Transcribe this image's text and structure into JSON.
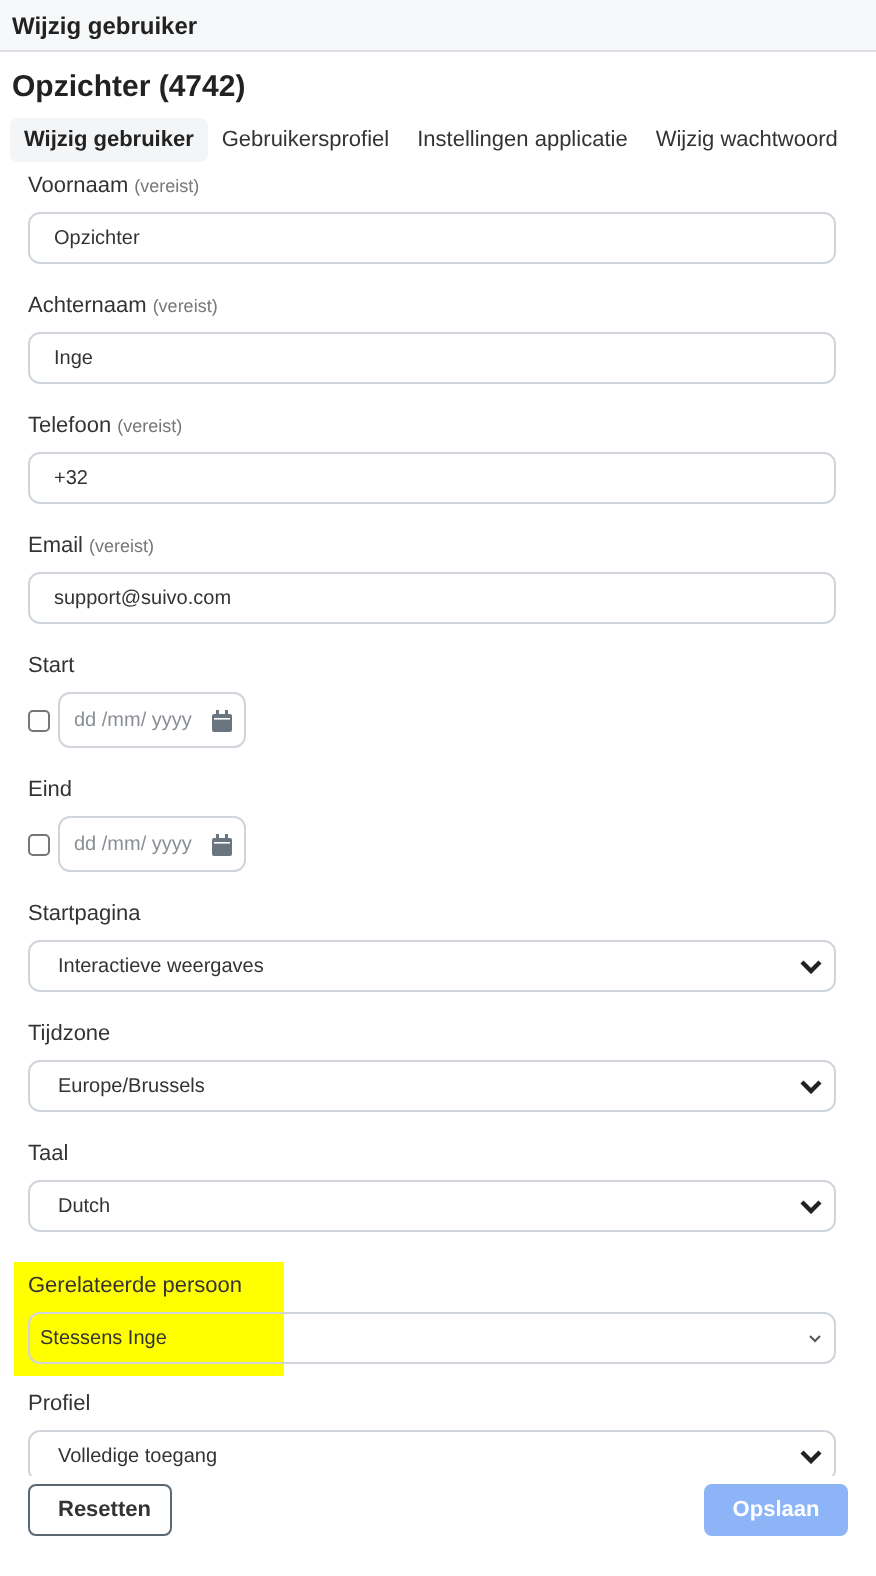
{
  "header": {
    "title": "Wijzig gebruiker"
  },
  "title": "Opzichter (4742)",
  "tabs": [
    {
      "label": "Wijzig gebruiker",
      "selected": true
    },
    {
      "label": "Gebruikersprofiel",
      "selected": false
    },
    {
      "label": "Instellingen applicatie",
      "selected": false
    },
    {
      "label": "Wijzig wachtwoord",
      "selected": false
    }
  ],
  "fields": [
    {
      "kind": "text",
      "label": "Voornaam",
      "note": "(vereist)",
      "value": "Opzichter"
    },
    {
      "kind": "text",
      "label": "Achternaam",
      "note": "(vereist)",
      "value": "Inge"
    },
    {
      "kind": "text",
      "label": "Telefoon",
      "note": "(vereist)",
      "value": "+32"
    },
    {
      "kind": "text",
      "label": "Email",
      "note": "(vereist)",
      "value": "support@suivo.com"
    },
    {
      "kind": "date",
      "label": "Start",
      "checked": false,
      "placeholder": "dd /mm/ yyyy"
    },
    {
      "kind": "date",
      "label": "Eind",
      "checked": false,
      "placeholder": "dd /mm/ yyyy"
    },
    {
      "kind": "select",
      "label": "Startpagina",
      "value": "Interactieve weergaves"
    },
    {
      "kind": "select",
      "label": "Tijdzone",
      "value": "Europe/Brussels"
    },
    {
      "kind": "select",
      "label": "Taal",
      "value": "Dutch"
    },
    {
      "kind": "combo",
      "label": "Gerelateerde persoon",
      "value": "Stessens Inge",
      "highlighted": true
    },
    {
      "kind": "select",
      "label": "Profiel",
      "value": "Volledige toegang"
    }
  ],
  "buttons": [
    {
      "label": "Resetten",
      "kind": "secondary",
      "disabled": false
    },
    {
      "label": "Opslaan",
      "kind": "primary",
      "disabled": true
    }
  ]
}
